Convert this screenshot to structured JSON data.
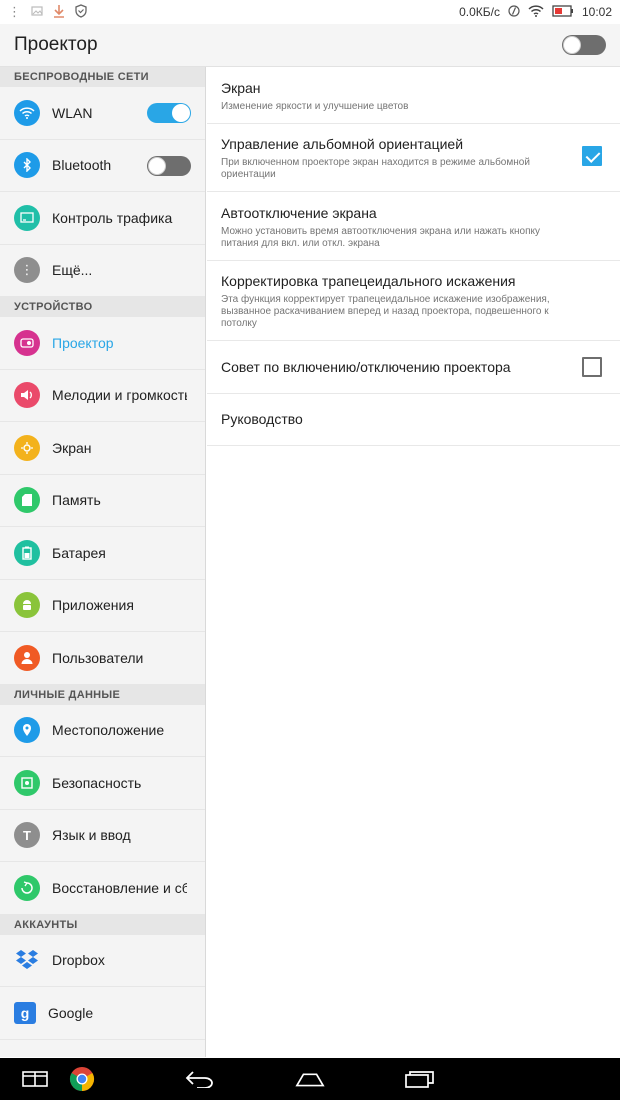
{
  "status_bar": {
    "speed": "0.0КБ/с",
    "time": "10:02"
  },
  "app_bar": {
    "title": "Проектор",
    "projector_switch": "off"
  },
  "sidebar": {
    "sections": [
      {
        "header": "БЕСПРОВОДНЫЕ СЕТИ",
        "items": [
          {
            "label": "WLAN",
            "icon": "wifi-icon",
            "color": "#1e9be8",
            "toggle": "on"
          },
          {
            "label": "Bluetooth",
            "icon": "bluetooth-icon",
            "color": "#1e9be8",
            "toggle": "off"
          },
          {
            "label": "Контроль трафика",
            "icon": "data-usage-icon",
            "color": "#20bfa8"
          },
          {
            "label": "Ещё...",
            "icon": "more-icon",
            "color": "#8e8e8e"
          }
        ]
      },
      {
        "header": "УСТРОЙСТВО",
        "items": [
          {
            "label": "Проектор",
            "icon": "projector-icon",
            "color": "#d6328f",
            "active": true
          },
          {
            "label": "Мелодии и громкость",
            "icon": "sound-icon",
            "color": "#ea4a6a"
          },
          {
            "label": "Экран",
            "icon": "display-icon",
            "color": "#f3b21c"
          },
          {
            "label": "Память",
            "icon": "storage-icon",
            "color": "#2fc86a"
          },
          {
            "label": "Батарея",
            "icon": "battery-icon",
            "color": "#20c0a0"
          },
          {
            "label": "Приложения",
            "icon": "android-icon",
            "color": "#8ac43a"
          },
          {
            "label": "Пользователи",
            "icon": "user-icon",
            "color": "#f05a24"
          }
        ]
      },
      {
        "header": "ЛИЧНЫЕ ДАННЫЕ",
        "items": [
          {
            "label": "Местоположение",
            "icon": "location-icon",
            "color": "#1e9be8"
          },
          {
            "label": "Безопасность",
            "icon": "lock-icon",
            "color": "#2fc86a"
          },
          {
            "label": "Язык и ввод",
            "icon": "text-icon",
            "color": "#8e8e8e"
          },
          {
            "label": "Восстановление и сброс",
            "icon": "restore-icon",
            "color": "#2fc86a"
          }
        ]
      },
      {
        "header": "АККАУНТЫ",
        "items": [
          {
            "label": "Dropbox",
            "icon": "dropbox-icon",
            "color": "#2a7de1"
          },
          {
            "label": "Google",
            "icon": "google-icon",
            "color": "#2a7de1"
          }
        ]
      }
    ]
  },
  "settings": {
    "items": [
      {
        "title": "Экран",
        "summary": "Изменение яркости и улучшение цветов"
      },
      {
        "title": "Управление альбомной ориентацией",
        "summary": "При включенном проекторе экран находится в режиме альбомной ориентации",
        "checkbox": true
      },
      {
        "title": "Автоотключение экрана",
        "summary": "Можно установить время автоотключения экрана или нажать кнопку питания для вкл. или откл. экрана"
      },
      {
        "title": "Корректировка трапецеидального искажения",
        "summary": "Эта функция корректирует трапецеидальное искажение изображения, вызванное раскачиванием вперед и назад проектора, подвешенного к потолку"
      },
      {
        "title": "Совет по включению/отключению проектора",
        "checkbox": false
      },
      {
        "title": "Руководство"
      }
    ]
  },
  "nav_bar": {
    "buttons": [
      "multiwindow-icon",
      "chrome-icon",
      "back-icon",
      "home-icon",
      "recents-icon"
    ]
  },
  "colors": {
    "accent": "#29a6e6"
  }
}
